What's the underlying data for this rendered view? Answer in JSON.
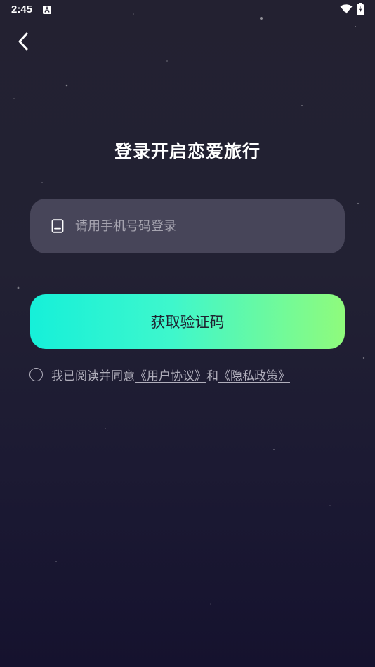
{
  "status_bar": {
    "time": "2:45"
  },
  "icons": {
    "back": "chevron-left-icon",
    "phone": "phone-icon",
    "notification": "notification-icon",
    "wifi": "wifi-icon",
    "battery": "battery-icon"
  },
  "title": "登录开启恋爱旅行",
  "phone_field": {
    "value": "",
    "placeholder": "请用手机号码登录"
  },
  "get_code_button": {
    "label": "获取验证码"
  },
  "agreement": {
    "prefix": "我已阅读并同意",
    "user_agreement": "《用户协议》",
    "connector": "和",
    "privacy_policy": "《隐私政策》",
    "checked": false
  },
  "colors": {
    "background_top": "#232131",
    "background_bottom": "#15122e",
    "field_bg": "#474559",
    "button_gradient_start": "#16f0d9",
    "button_gradient_end": "#8ffb7c",
    "muted_text": "#b0aebb"
  }
}
